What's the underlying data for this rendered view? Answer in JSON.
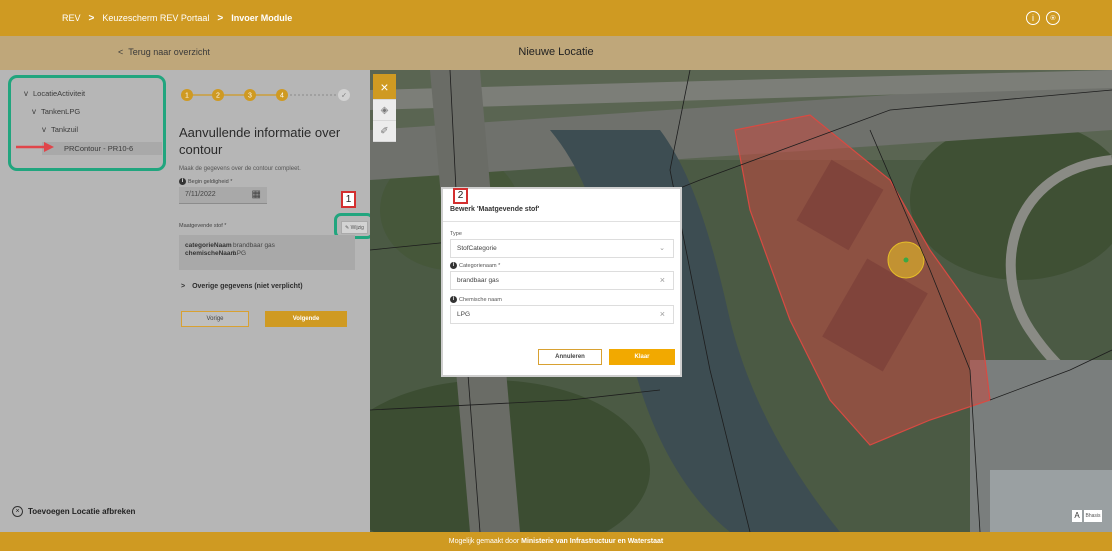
{
  "topbar": {
    "breadcrumbs": [
      "REV",
      "Keuzescherm REV Portaal",
      "Invoer Module"
    ],
    "separator": ">",
    "info_glyph": "i",
    "user_glyph": "⍟",
    "icons": [
      "info-icon",
      "user-icon"
    ]
  },
  "subbar": {
    "back_label": "Terug naar overzicht",
    "back_glyph": "<",
    "title": "Nieuwe Locatie"
  },
  "tree": {
    "items": [
      {
        "label": "LocatieActiviteit",
        "chevron": "v"
      },
      {
        "label": "TankenLPG",
        "chevron": "v"
      },
      {
        "label": "Tankzuil",
        "chevron": "v"
      },
      {
        "label": "PRContour - PR10-6",
        "chevron": ""
      }
    ],
    "highlight_color": "#21a57e",
    "arrow_color": "#d32f2f"
  },
  "abort": {
    "label": "Toevoegen Locatie afbreken",
    "glyph": "×"
  },
  "form": {
    "steps": [
      "1",
      "2",
      "3",
      "4",
      "✓"
    ],
    "title": "Aanvullende informatie over contour",
    "subtitle": "Maak de gegevens over de contour compleet.",
    "start_label": "Begin geldigheid *",
    "start_value": "7/11/2022",
    "calendar_glyph": "▦",
    "stof_label": "Maatgevende stof *",
    "edit_label": "Wijzig",
    "edit_glyph": "✎",
    "badge": "1",
    "stof_rows": [
      {
        "key": "categorieNaam",
        "value": "brandbaar gas"
      },
      {
        "key": "chemischeNaam",
        "value": "LPG"
      }
    ],
    "overige_label": "Overige gegevens (niet verplicht)",
    "overige_glyph": ">",
    "prev_label": "Vorige",
    "next_label": "Volgende"
  },
  "map": {
    "tool_close": "×",
    "tool_layers": "◈",
    "tool_edit": "✐",
    "attribution_letter": "A",
    "scale_text": "Bhasis"
  },
  "dialog": {
    "badge": "2",
    "title": "Bewerk 'Maatgevende stof'",
    "type_label": "Type",
    "type_value": "StofCategorie",
    "type_glyph": "⌄",
    "cat_label": "Categorienaam *",
    "cat_value": "brandbaar gas",
    "chem_label": "Chemische naam",
    "chem_value": "LPG",
    "clear_glyph": "×",
    "cancel_label": "Annuleren",
    "done_label": "Klaar"
  },
  "footer": {
    "prefix": "Mogelijk gemaakt door",
    "org": "Ministerie van Infrastructuur en Waterstaat"
  },
  "colors": {
    "brand": "#cf9a22",
    "accent_button": "#f2a900",
    "annotation_green": "#21a57e",
    "annotation_red": "#d32f2f"
  }
}
